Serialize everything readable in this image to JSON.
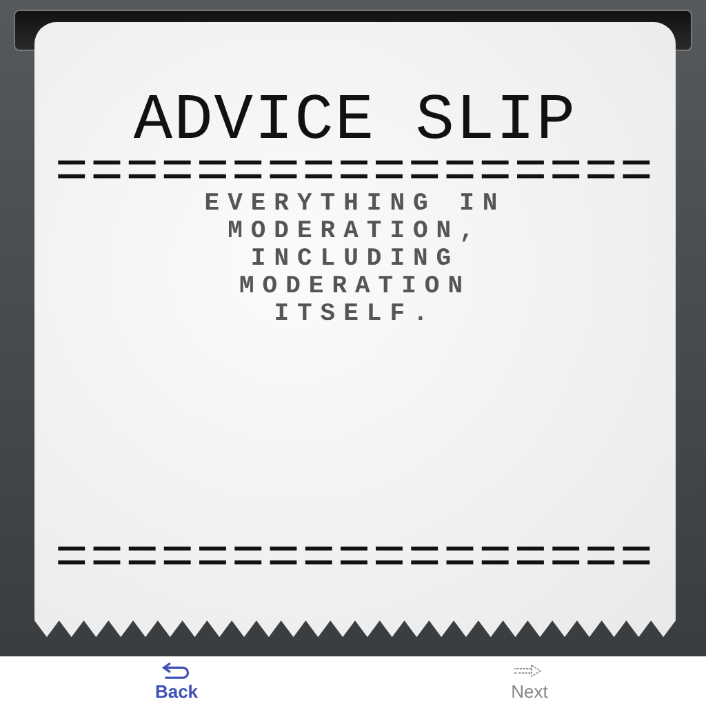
{
  "slip": {
    "title": "ADVICE SLIP",
    "top_divider": "=================",
    "advice": "EVERYTHING IN MODERATION, INCLUDING MODERATION ITSELF.",
    "bottom_divider": "================="
  },
  "nav": [
    {
      "label": "Back",
      "kind": "back",
      "disabled": false
    },
    {
      "label": "Next",
      "kind": "next",
      "disabled": true
    }
  ]
}
